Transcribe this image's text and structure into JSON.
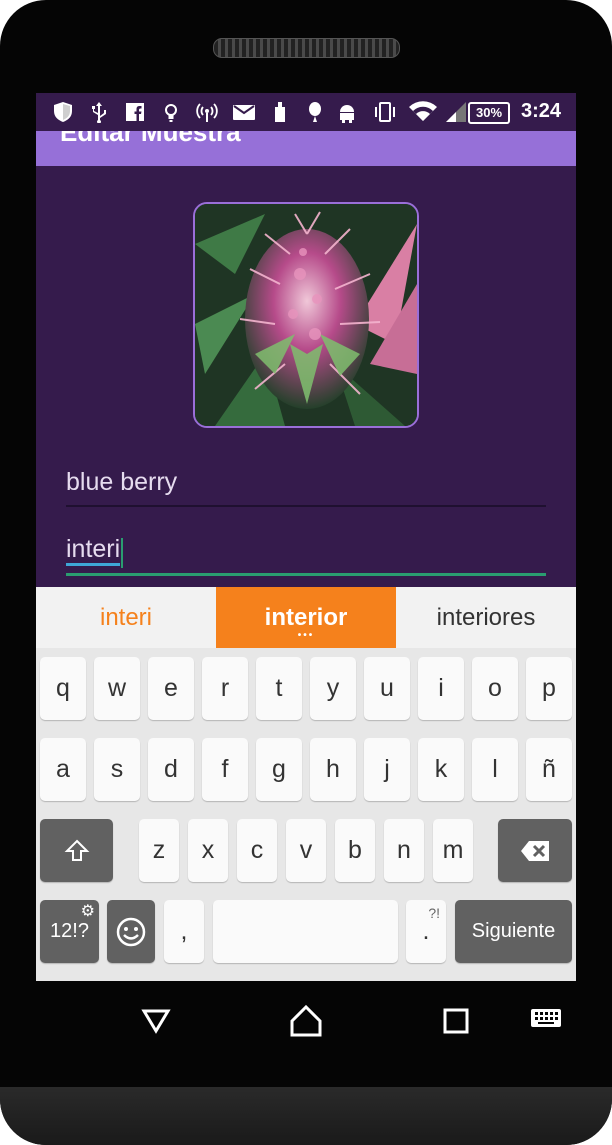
{
  "status_bar": {
    "battery": "30%",
    "time": "3:24"
  },
  "app_bar": {
    "title": "Editar Muestra"
  },
  "form": {
    "name_value": "blue berry",
    "location_value": "interi"
  },
  "suggestions": {
    "left": "interi",
    "center": "interior",
    "right": "interiores"
  },
  "keyboard": {
    "row1": [
      "q",
      "w",
      "e",
      "r",
      "t",
      "y",
      "u",
      "i",
      "o",
      "p"
    ],
    "row2": [
      "a",
      "s",
      "d",
      "f",
      "g",
      "h",
      "j",
      "k",
      "l",
      "ñ"
    ],
    "row3": [
      "z",
      "x",
      "c",
      "v",
      "b",
      "n",
      "m"
    ],
    "symbols_label": "12!?",
    "comma": ",",
    "period": ".",
    "period_alt": "?!",
    "action_label": "Siguiente"
  },
  "colors": {
    "background": "#351b4c",
    "app_bar": "#9670d8",
    "accent": "#f5811c",
    "field_active": "#2a9d70"
  }
}
